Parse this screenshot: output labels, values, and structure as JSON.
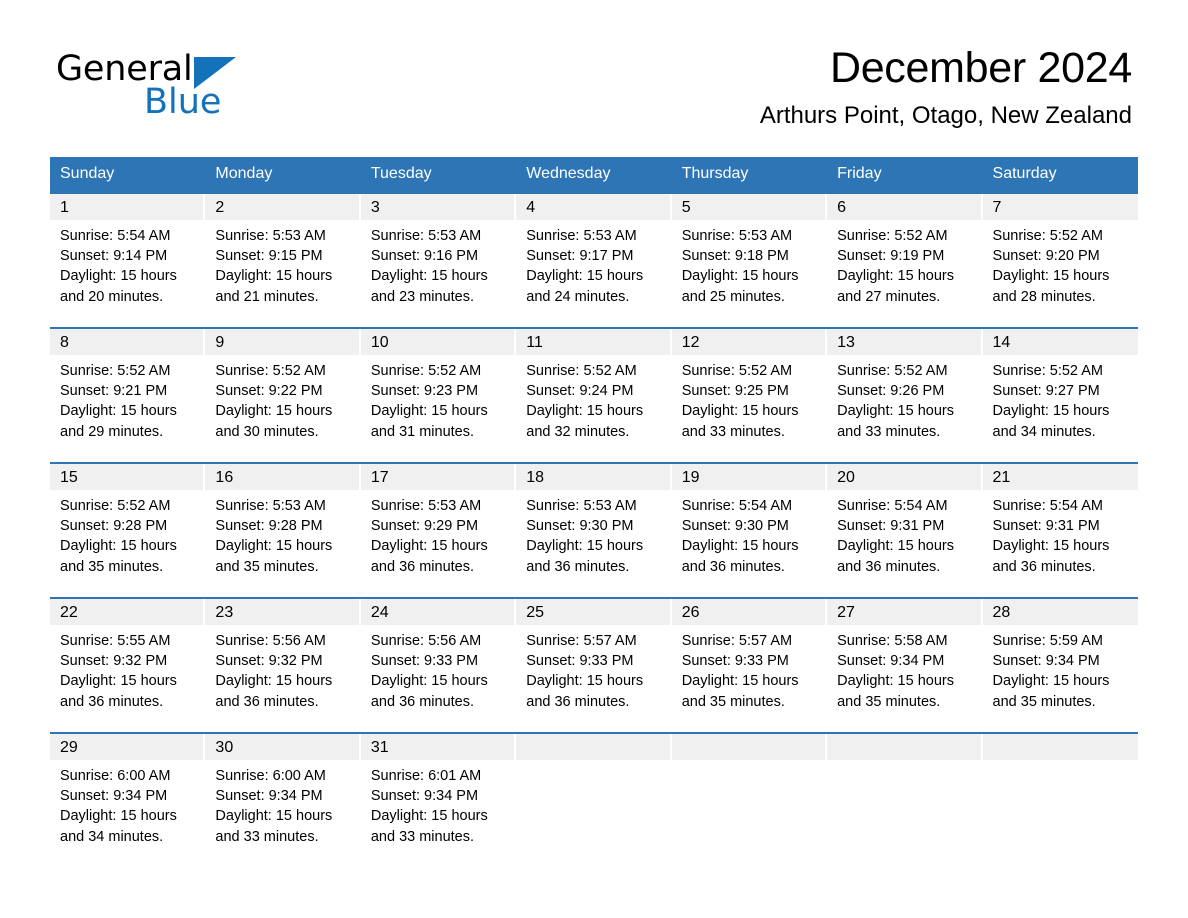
{
  "brand": {
    "line1": "General",
    "line2": "Blue",
    "triangle_color": "#1372b9",
    "text_color": "#000000"
  },
  "header": {
    "title": "December 2024",
    "subtitle": "Arthurs Point, Otago, New Zealand"
  },
  "theme": {
    "header_blue": "#2e75b6",
    "row_divider_blue": "#2e75b6",
    "daynum_band": "#f0f0f0",
    "page_background": "#ffffff"
  },
  "calendar": {
    "weekday_headers": [
      "Sunday",
      "Monday",
      "Tuesday",
      "Wednesday",
      "Thursday",
      "Friday",
      "Saturday"
    ],
    "weeks": [
      [
        {
          "day": "1",
          "sunrise": "Sunrise: 5:54 AM",
          "sunset": "Sunset: 9:14 PM",
          "daylight_line1": "Daylight: 15 hours",
          "daylight_line2": "and 20 minutes."
        },
        {
          "day": "2",
          "sunrise": "Sunrise: 5:53 AM",
          "sunset": "Sunset: 9:15 PM",
          "daylight_line1": "Daylight: 15 hours",
          "daylight_line2": "and 21 minutes."
        },
        {
          "day": "3",
          "sunrise": "Sunrise: 5:53 AM",
          "sunset": "Sunset: 9:16 PM",
          "daylight_line1": "Daylight: 15 hours",
          "daylight_line2": "and 23 minutes."
        },
        {
          "day": "4",
          "sunrise": "Sunrise: 5:53 AM",
          "sunset": "Sunset: 9:17 PM",
          "daylight_line1": "Daylight: 15 hours",
          "daylight_line2": "and 24 minutes."
        },
        {
          "day": "5",
          "sunrise": "Sunrise: 5:53 AM",
          "sunset": "Sunset: 9:18 PM",
          "daylight_line1": "Daylight: 15 hours",
          "daylight_line2": "and 25 minutes."
        },
        {
          "day": "6",
          "sunrise": "Sunrise: 5:52 AM",
          "sunset": "Sunset: 9:19 PM",
          "daylight_line1": "Daylight: 15 hours",
          "daylight_line2": "and 27 minutes."
        },
        {
          "day": "7",
          "sunrise": "Sunrise: 5:52 AM",
          "sunset": "Sunset: 9:20 PM",
          "daylight_line1": "Daylight: 15 hours",
          "daylight_line2": "and 28 minutes."
        }
      ],
      [
        {
          "day": "8",
          "sunrise": "Sunrise: 5:52 AM",
          "sunset": "Sunset: 9:21 PM",
          "daylight_line1": "Daylight: 15 hours",
          "daylight_line2": "and 29 minutes."
        },
        {
          "day": "9",
          "sunrise": "Sunrise: 5:52 AM",
          "sunset": "Sunset: 9:22 PM",
          "daylight_line1": "Daylight: 15 hours",
          "daylight_line2": "and 30 minutes."
        },
        {
          "day": "10",
          "sunrise": "Sunrise: 5:52 AM",
          "sunset": "Sunset: 9:23 PM",
          "daylight_line1": "Daylight: 15 hours",
          "daylight_line2": "and 31 minutes."
        },
        {
          "day": "11",
          "sunrise": "Sunrise: 5:52 AM",
          "sunset": "Sunset: 9:24 PM",
          "daylight_line1": "Daylight: 15 hours",
          "daylight_line2": "and 32 minutes."
        },
        {
          "day": "12",
          "sunrise": "Sunrise: 5:52 AM",
          "sunset": "Sunset: 9:25 PM",
          "daylight_line1": "Daylight: 15 hours",
          "daylight_line2": "and 33 minutes."
        },
        {
          "day": "13",
          "sunrise": "Sunrise: 5:52 AM",
          "sunset": "Sunset: 9:26 PM",
          "daylight_line1": "Daylight: 15 hours",
          "daylight_line2": "and 33 minutes."
        },
        {
          "day": "14",
          "sunrise": "Sunrise: 5:52 AM",
          "sunset": "Sunset: 9:27 PM",
          "daylight_line1": "Daylight: 15 hours",
          "daylight_line2": "and 34 minutes."
        }
      ],
      [
        {
          "day": "15",
          "sunrise": "Sunrise: 5:52 AM",
          "sunset": "Sunset: 9:28 PM",
          "daylight_line1": "Daylight: 15 hours",
          "daylight_line2": "and 35 minutes."
        },
        {
          "day": "16",
          "sunrise": "Sunrise: 5:53 AM",
          "sunset": "Sunset: 9:28 PM",
          "daylight_line1": "Daylight: 15 hours",
          "daylight_line2": "and 35 minutes."
        },
        {
          "day": "17",
          "sunrise": "Sunrise: 5:53 AM",
          "sunset": "Sunset: 9:29 PM",
          "daylight_line1": "Daylight: 15 hours",
          "daylight_line2": "and 36 minutes."
        },
        {
          "day": "18",
          "sunrise": "Sunrise: 5:53 AM",
          "sunset": "Sunset: 9:30 PM",
          "daylight_line1": "Daylight: 15 hours",
          "daylight_line2": "and 36 minutes."
        },
        {
          "day": "19",
          "sunrise": "Sunrise: 5:54 AM",
          "sunset": "Sunset: 9:30 PM",
          "daylight_line1": "Daylight: 15 hours",
          "daylight_line2": "and 36 minutes."
        },
        {
          "day": "20",
          "sunrise": "Sunrise: 5:54 AM",
          "sunset": "Sunset: 9:31 PM",
          "daylight_line1": "Daylight: 15 hours",
          "daylight_line2": "and 36 minutes."
        },
        {
          "day": "21",
          "sunrise": "Sunrise: 5:54 AM",
          "sunset": "Sunset: 9:31 PM",
          "daylight_line1": "Daylight: 15 hours",
          "daylight_line2": "and 36 minutes."
        }
      ],
      [
        {
          "day": "22",
          "sunrise": "Sunrise: 5:55 AM",
          "sunset": "Sunset: 9:32 PM",
          "daylight_line1": "Daylight: 15 hours",
          "daylight_line2": "and 36 minutes."
        },
        {
          "day": "23",
          "sunrise": "Sunrise: 5:56 AM",
          "sunset": "Sunset: 9:32 PM",
          "daylight_line1": "Daylight: 15 hours",
          "daylight_line2": "and 36 minutes."
        },
        {
          "day": "24",
          "sunrise": "Sunrise: 5:56 AM",
          "sunset": "Sunset: 9:33 PM",
          "daylight_line1": "Daylight: 15 hours",
          "daylight_line2": "and 36 minutes."
        },
        {
          "day": "25",
          "sunrise": "Sunrise: 5:57 AM",
          "sunset": "Sunset: 9:33 PM",
          "daylight_line1": "Daylight: 15 hours",
          "daylight_line2": "and 36 minutes."
        },
        {
          "day": "26",
          "sunrise": "Sunrise: 5:57 AM",
          "sunset": "Sunset: 9:33 PM",
          "daylight_line1": "Daylight: 15 hours",
          "daylight_line2": "and 35 minutes."
        },
        {
          "day": "27",
          "sunrise": "Sunrise: 5:58 AM",
          "sunset": "Sunset: 9:34 PM",
          "daylight_line1": "Daylight: 15 hours",
          "daylight_line2": "and 35 minutes."
        },
        {
          "day": "28",
          "sunrise": "Sunrise: 5:59 AM",
          "sunset": "Sunset: 9:34 PM",
          "daylight_line1": "Daylight: 15 hours",
          "daylight_line2": "and 35 minutes."
        }
      ],
      [
        {
          "day": "29",
          "sunrise": "Sunrise: 6:00 AM",
          "sunset": "Sunset: 9:34 PM",
          "daylight_line1": "Daylight: 15 hours",
          "daylight_line2": "and 34 minutes."
        },
        {
          "day": "30",
          "sunrise": "Sunrise: 6:00 AM",
          "sunset": "Sunset: 9:34 PM",
          "daylight_line1": "Daylight: 15 hours",
          "daylight_line2": "and 33 minutes."
        },
        {
          "day": "31",
          "sunrise": "Sunrise: 6:01 AM",
          "sunset": "Sunset: 9:34 PM",
          "daylight_line1": "Daylight: 15 hours",
          "daylight_line2": "and 33 minutes."
        },
        {
          "day": "",
          "sunrise": "",
          "sunset": "",
          "daylight_line1": "",
          "daylight_line2": ""
        },
        {
          "day": "",
          "sunrise": "",
          "sunset": "",
          "daylight_line1": "",
          "daylight_line2": ""
        },
        {
          "day": "",
          "sunrise": "",
          "sunset": "",
          "daylight_line1": "",
          "daylight_line2": ""
        },
        {
          "day": "",
          "sunrise": "",
          "sunset": "",
          "daylight_line1": "",
          "daylight_line2": ""
        }
      ]
    ]
  }
}
